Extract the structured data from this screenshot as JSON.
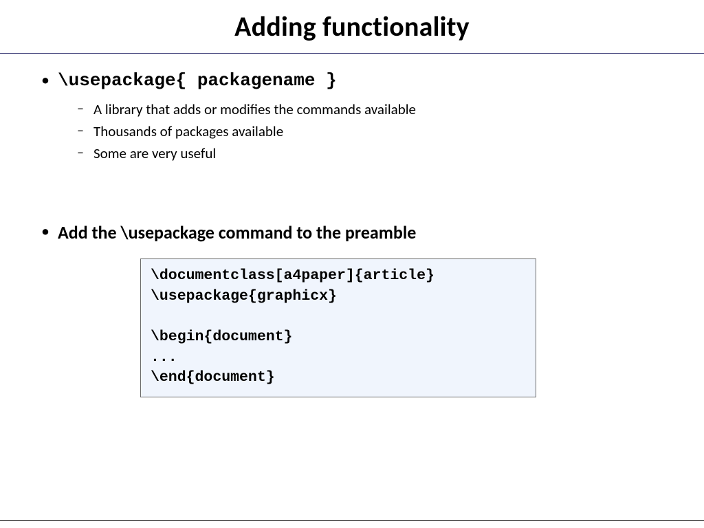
{
  "title": "Adding functionality",
  "bullets": {
    "b1": {
      "text": "\\usepackage{ packagename }",
      "subs": [
        "A library that adds or modifies the commands available",
        "Thousands of packages available",
        "Some are very useful"
      ]
    },
    "b2": {
      "text": "Add the \\usepackage command to the preamble"
    }
  },
  "code": {
    "l1": "\\documentclass[a4paper]{article}",
    "l2": "\\usepackage{graphicx}",
    "l3": "",
    "l4": "\\begin{document}",
    "l5": "...",
    "l6": "\\end{document}"
  }
}
